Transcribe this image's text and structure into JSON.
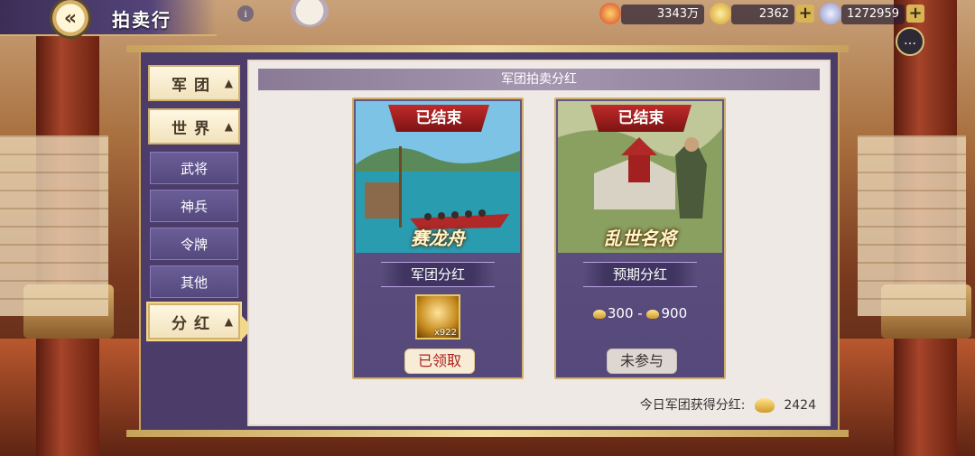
{
  "header": {
    "title": "拍卖行",
    "resources": [
      {
        "icon": "war-power-icon",
        "value": "3343万"
      },
      {
        "icon": "gold-ingot-icon",
        "value": "2362"
      },
      {
        "icon": "silver-coin-icon",
        "value": "1272959"
      }
    ]
  },
  "sidebar": {
    "tabs": [
      {
        "label": "军团"
      },
      {
        "label": "世界"
      },
      {
        "label": "武将"
      },
      {
        "label": "神兵"
      },
      {
        "label": "令牌"
      },
      {
        "label": "其他"
      },
      {
        "label": "分红"
      }
    ]
  },
  "section": {
    "title": "军团拍卖分红"
  },
  "cards": [
    {
      "status": "已结束",
      "event": "赛龙舟",
      "label": "军团分红",
      "reward_count": "x922",
      "button": "已领取"
    },
    {
      "status": "已结束",
      "event": "乱世名将",
      "label": "预期分红",
      "range_min": "300",
      "range_sep": "-",
      "range_max": "900",
      "button": "未参与"
    }
  ],
  "footer": {
    "label": "今日军团获得分红:",
    "value": "2424"
  },
  "colors": {
    "accent": "#cfb06a",
    "panel": "#55487a",
    "ribbon": "#c12a2a"
  }
}
